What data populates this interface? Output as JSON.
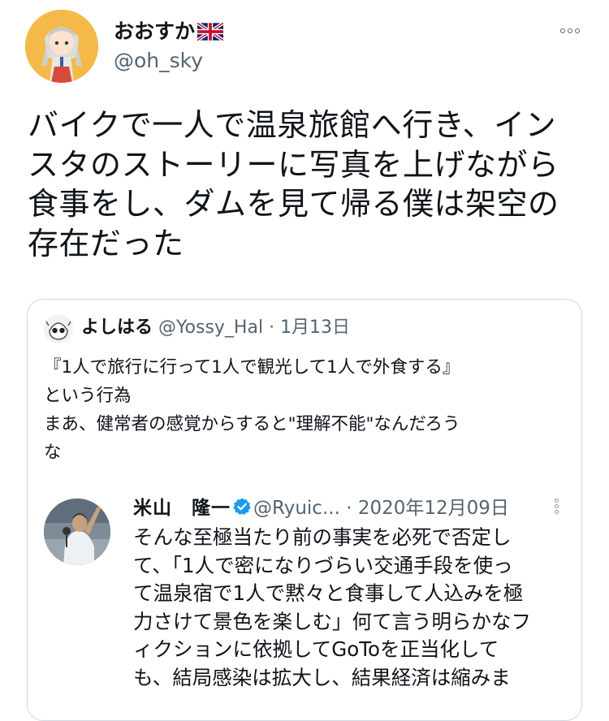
{
  "tweet": {
    "author": {
      "display_name": "おおすか",
      "handle": "@oh_sky",
      "flag_icon": "uk-flag-icon"
    },
    "text_lines": [
      "バイクで一人で温泉旅館へ行き、イン",
      "スタのストーリーに写真を上げながら",
      "食事をし、ダムを見て帰る僕は架空の",
      "存在だった"
    ]
  },
  "quote": {
    "author": {
      "name": "よしはる",
      "handle": "@Yossy_Hal",
      "separator": " · ",
      "date": "1月13日"
    },
    "text_lines": [
      "『1人で旅行に行って1人で観光して1人で外食する』",
      "という行為",
      "まあ、健常者の感覚からすると\"理解不能\"なんだろう",
      "な"
    ],
    "inner": {
      "author": {
        "name": "米山　隆一",
        "handle": "@Ryuic...",
        "separator": " · ",
        "date": "2020年12月09日"
      },
      "text_lines": [
        "そんな至極当たり前の事実を必死で否定し",
        "て、「1人で密になりづらい交通手段を使っ",
        "て温泉宿で1人で黙々と食事して人込みを極",
        "力さけて景色を楽しむ」何て言う明らかなフ",
        "ィクションに依拠してGoToを正当化して",
        "も、結局感染は拡大し、結果経済は縮みま"
      ]
    }
  },
  "colors": {
    "text": "#0f1419",
    "secondary": "#536471",
    "border": "#cfd9de",
    "verified": "#1d9bf0"
  }
}
